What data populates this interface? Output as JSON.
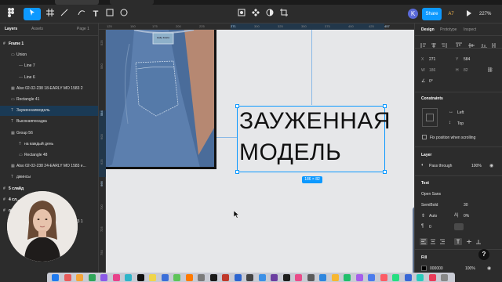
{
  "toolbar": {
    "share_label": "Share",
    "ai_label": "A7",
    "zoom": "227%",
    "avatar_initial": "K"
  },
  "left_panel": {
    "tabs": [
      "Layers",
      "Assets"
    ],
    "page_selector": "Page 1",
    "layers": [
      {
        "label": "Frame 1",
        "icon": "#",
        "bold": true
      },
      {
        "label": "Union",
        "icon": "▭"
      },
      {
        "label": "Line 7",
        "icon": "—"
      },
      {
        "label": "Line 6",
        "icon": "—"
      },
      {
        "label": "Also 02-02-238 18-EARLY MO 1583 2",
        "icon": "▦"
      },
      {
        "label": "Rectangle 41",
        "icon": "▭"
      },
      {
        "label": "Зауженнаямодель",
        "icon": "T",
        "selected": true
      },
      {
        "label": "Высокаяпосадка",
        "icon": "T"
      },
      {
        "label": "Group 56",
        "icon": "▦"
      },
      {
        "label": "на каждый день",
        "icon": "T"
      },
      {
        "label": "Rectangle 48",
        "icon": "▭"
      },
      {
        "label": "Also 02-02-238 24-EARLY MO 1583 e...",
        "icon": "▦"
      },
      {
        "label": "джинсы",
        "icon": "T"
      },
      {
        "label": "5 слайд",
        "icon": "#",
        "bold": true
      },
      {
        "label": "4 сл...",
        "icon": "#",
        "bold": true
      },
      {
        "label": "обл...",
        "icon": "#",
        "bold": true
      },
      {
        "label": "Also 02-02-238 18-EARLY MO 1583 1",
        "icon": "▦"
      }
    ]
  },
  "canvas": {
    "ruler_x": [
      "125",
      "150",
      "175",
      "200",
      "225",
      "271",
      "300",
      "325",
      "350",
      "375",
      "400",
      "425",
      "457"
    ],
    "ruler_y": [
      "525",
      "550",
      "584",
      "600",
      "625",
      "666",
      "700",
      "725",
      "750",
      "775"
    ],
    "title_line1": "ЗАУЖЕННАЯ",
    "title_line2": "МОДЕЛЬ",
    "selection_size": "186 × 82",
    "label_tag": "Lady Jeans"
  },
  "right_panel": {
    "tabs": [
      "Design",
      "Prototype",
      "Inspect"
    ],
    "x_label": "X",
    "x_value": "271",
    "y_label": "Y",
    "y_value": "584",
    "w_label": "W",
    "w_value": "186",
    "h_label": "H",
    "h_value": "82",
    "rotation": "0°",
    "constraints_title": "Constraints",
    "constraint_h": "Left",
    "constraint_v": "Top",
    "fix_position": "Fix position when scrolling",
    "layer_title": "Layer",
    "layer_blend": "Pass through",
    "layer_opacity": "100%",
    "text_title": "Text",
    "font_family": "Open Sans",
    "font_weight": "SemiBold",
    "font_size": "30",
    "line_height": "Auto",
    "letter_spacing": "0%",
    "paragraph_spacing": "0",
    "fill_title": "Fill",
    "fill_hex": "000000",
    "fill_opacity": "100%"
  },
  "colors": {
    "accent": "#0d99ff",
    "panel_bg": "#2c2c2c",
    "canvas_bg": "#e5e5e5"
  }
}
